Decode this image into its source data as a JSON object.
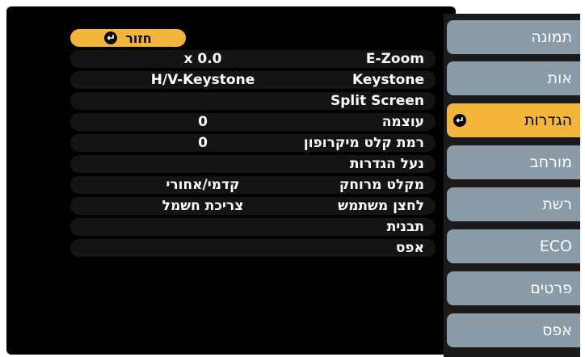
{
  "back_label": "חזור",
  "settings": [
    {
      "name": "E-Zoom",
      "value": "x  0.0"
    },
    {
      "name": "Keystone",
      "value": "H/V-Keystone"
    },
    {
      "name": "Split Screen",
      "value": ""
    },
    {
      "name": "עוצמה",
      "value": "0"
    },
    {
      "name": "רמת קלט מיקרופון",
      "value": "0"
    },
    {
      "name": "נעל הגדרות",
      "value": ""
    },
    {
      "name": "מקלט מרוחק",
      "value": "קדמי/אחורי"
    },
    {
      "name": "לחצן משתמש",
      "value": "צריכת חשמל"
    },
    {
      "name": "תבנית",
      "value": ""
    },
    {
      "name": "אפס",
      "value": ""
    }
  ],
  "tabs": [
    {
      "label": "תמונה",
      "active": false
    },
    {
      "label": "אות",
      "active": false
    },
    {
      "label": "הגדרות",
      "active": true
    },
    {
      "label": "מורחב",
      "active": false
    },
    {
      "label": "רשת",
      "active": false
    },
    {
      "label": "ECO",
      "active": false
    },
    {
      "label": "פרטים",
      "active": false
    },
    {
      "label": "אפס",
      "active": false
    }
  ],
  "colors": {
    "accent": "#f3b53b",
    "tab": "#8a9aa6",
    "panel": "#000000",
    "row": "#141414"
  },
  "icons": {
    "enter": "enter-icon"
  }
}
